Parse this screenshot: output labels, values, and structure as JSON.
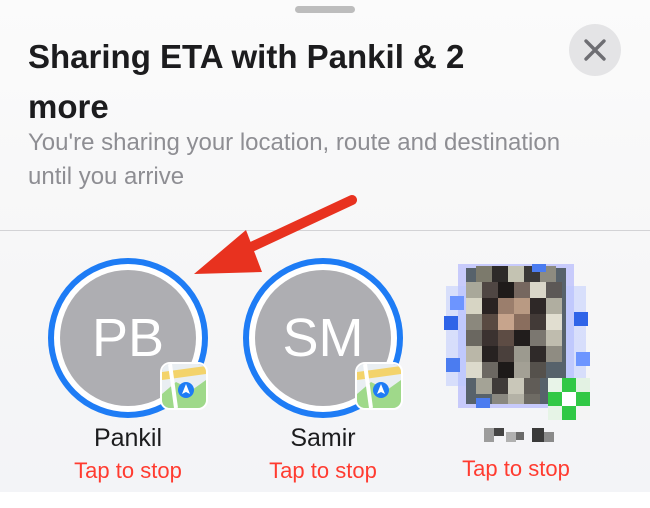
{
  "sheet": {
    "title": "Sharing ETA with Pankil & 2 more",
    "subtitle": "You're sharing your location, route and destination until you arrive",
    "close_icon": "close-icon"
  },
  "contacts": [
    {
      "initials": "PB",
      "name": "Pankil",
      "action": "Tap to stop",
      "badge": "maps-app-icon"
    },
    {
      "initials": "SM",
      "name": "Samir",
      "action": "Tap to stop",
      "badge": "maps-app-icon"
    },
    {
      "initials": "",
      "name": "",
      "action": "Tap to stop",
      "badge": "messages-app-icon"
    }
  ],
  "colors": {
    "ring": "#1e7cf5",
    "stop": "#ff3b30",
    "annotation_arrow": "#e8321f"
  }
}
